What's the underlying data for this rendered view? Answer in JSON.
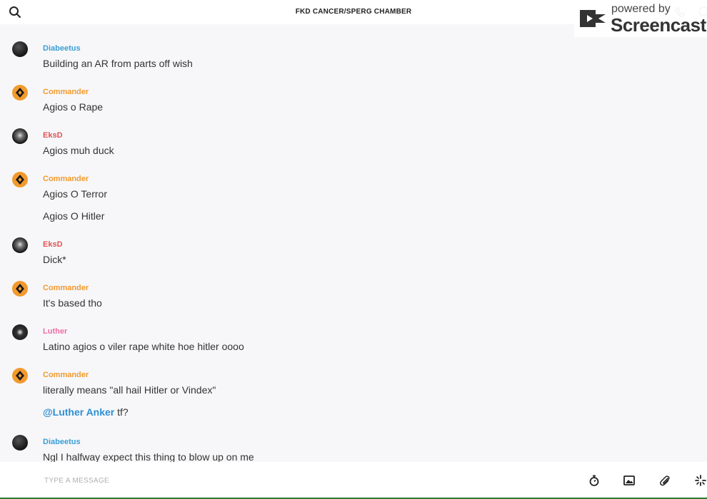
{
  "header": {
    "title": "FKD CANCER/SPERG CHAMBER"
  },
  "watermark": {
    "small": "powered by",
    "big": "Screencastify"
  },
  "messages": [
    {
      "user": "Diabeetus",
      "lines": [
        "Building an AR from parts off wish"
      ]
    },
    {
      "user": "Commander",
      "lines": [
        "Agios o Rape"
      ]
    },
    {
      "user": "EksD",
      "lines": [
        "Agios muh duck"
      ]
    },
    {
      "user": "Commander",
      "lines": [
        "Agios O Terror",
        "Agios O Hitler"
      ]
    },
    {
      "user": "EksD",
      "lines": [
        "Dick*"
      ]
    },
    {
      "user": "Commander",
      "lines": [
        "It's based tho"
      ]
    },
    {
      "user": "Luther",
      "lines": [
        "Latino agios o viler rape white hoe hitler oooo"
      ]
    },
    {
      "user": "Commander",
      "lines": [
        "literally means \"all hail Hitler or Vindex\""
      ],
      "extra": {
        "mention": "@Luther Anker",
        "rest": " tf?"
      }
    },
    {
      "user": "Diabeetus",
      "lines": [
        "Ngl I halfway expect this thing to blow up on me"
      ]
    }
  ],
  "composer": {
    "placeholder": "TYPE A MESSAGE"
  },
  "icons": {
    "search": "search-icon",
    "phone": "phone-icon",
    "info": "info-icon",
    "timer": "timer-icon",
    "image": "image-icon",
    "attach": "paperclip-icon",
    "sparkle": "sparkle-icon"
  },
  "colors": {
    "diabeetus": "#3a9fd6",
    "commander": "#f29a2e",
    "eksd": "#e25454",
    "luther": "#ee6fa3",
    "mention": "#2d8fd5"
  }
}
